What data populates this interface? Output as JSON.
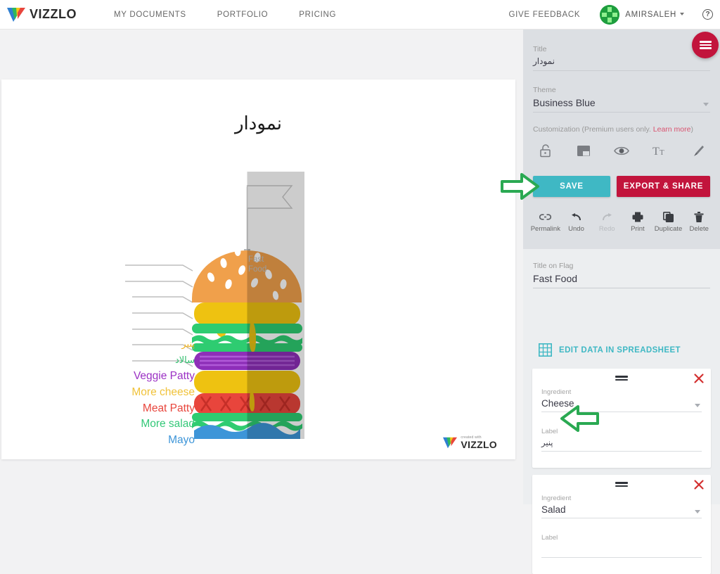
{
  "navbar": {
    "brand": "VIZZLO",
    "links": [
      {
        "label": "MY DOCUMENTS"
      },
      {
        "label": "PORTFOLIO"
      },
      {
        "label": "PRICING"
      }
    ],
    "feedback": "GIVE FEEDBACK",
    "username": "AMIRSALEH",
    "help_glyph": "?"
  },
  "chart": {
    "title": "نمودار",
    "flag_text": "Fast Food",
    "watermark_small": "created with",
    "watermark_big": "VIZZLO",
    "labels": [
      {
        "text": "پنیر",
        "color": "#f0b323",
        "rtl": true
      },
      {
        "text": "سالاد",
        "color": "#2ebd6b",
        "rtl": true
      },
      {
        "text": "Veggie Patty",
        "color": "#9b30c4",
        "rtl": false
      },
      {
        "text": "More cheese",
        "color": "#f0c23a",
        "rtl": false
      },
      {
        "text": "Meat Patty",
        "color": "#e8453c",
        "rtl": false
      },
      {
        "text": "More salad",
        "color": "#33c878",
        "rtl": false
      },
      {
        "text": "Mayo",
        "color": "#3d95d8",
        "rtl": false
      }
    ],
    "layer_colors": {
      "bun_top": "#f0a04b",
      "cheese": "#eec211",
      "salad": "#2ecc71",
      "veggie_patty": "#8e2fb8",
      "more_cheese": "#eec211",
      "meat_patty": "#e8453c",
      "more_salad": "#2ecc71",
      "mayo": "#3d95d8",
      "bun_bottom": "#f0a04b"
    }
  },
  "sidebar": {
    "title_field": {
      "label": "Title",
      "value": "نمودار"
    },
    "theme_field": {
      "label": "Theme",
      "value": "Business Blue"
    },
    "customization": {
      "note_prefix": "Customization (Premium users only. ",
      "learn_more": "Learn more",
      "note_suffix": ")",
      "icons": [
        {
          "name": "unlock-icon"
        },
        {
          "name": "layout-icon"
        },
        {
          "name": "eye-icon"
        },
        {
          "name": "text-size-icon"
        },
        {
          "name": "brush-icon"
        }
      ]
    },
    "save_label": "SAVE",
    "export_label": "EXPORT & SHARE",
    "tools": [
      {
        "label": "Permalink",
        "icon": "link-icon",
        "disabled": false
      },
      {
        "label": "Undo",
        "icon": "undo-icon",
        "disabled": false
      },
      {
        "label": "Redo",
        "icon": "redo-icon",
        "disabled": true
      },
      {
        "label": "Print",
        "icon": "printer-icon",
        "disabled": false
      },
      {
        "label": "Duplicate",
        "icon": "copy-icon",
        "disabled": false
      },
      {
        "label": "Delete",
        "icon": "trash-icon",
        "disabled": false
      }
    ],
    "flag_title_field": {
      "label": "Title on Flag",
      "value": "Fast Food"
    },
    "spreadsheet_link": "EDIT DATA IN SPREADSHEET",
    "cards": [
      {
        "ingredient_label": "Ingredient",
        "ingredient_value": "Cheese",
        "label_label": "Label",
        "label_value": "پنیر"
      },
      {
        "ingredient_label": "Ingredient",
        "ingredient_value": "Salad",
        "label_label": "Label",
        "label_value": ""
      }
    ],
    "accent_teal": "#3fb8c4",
    "accent_red": "#c2143c",
    "annotation_green": "#2aa952"
  }
}
